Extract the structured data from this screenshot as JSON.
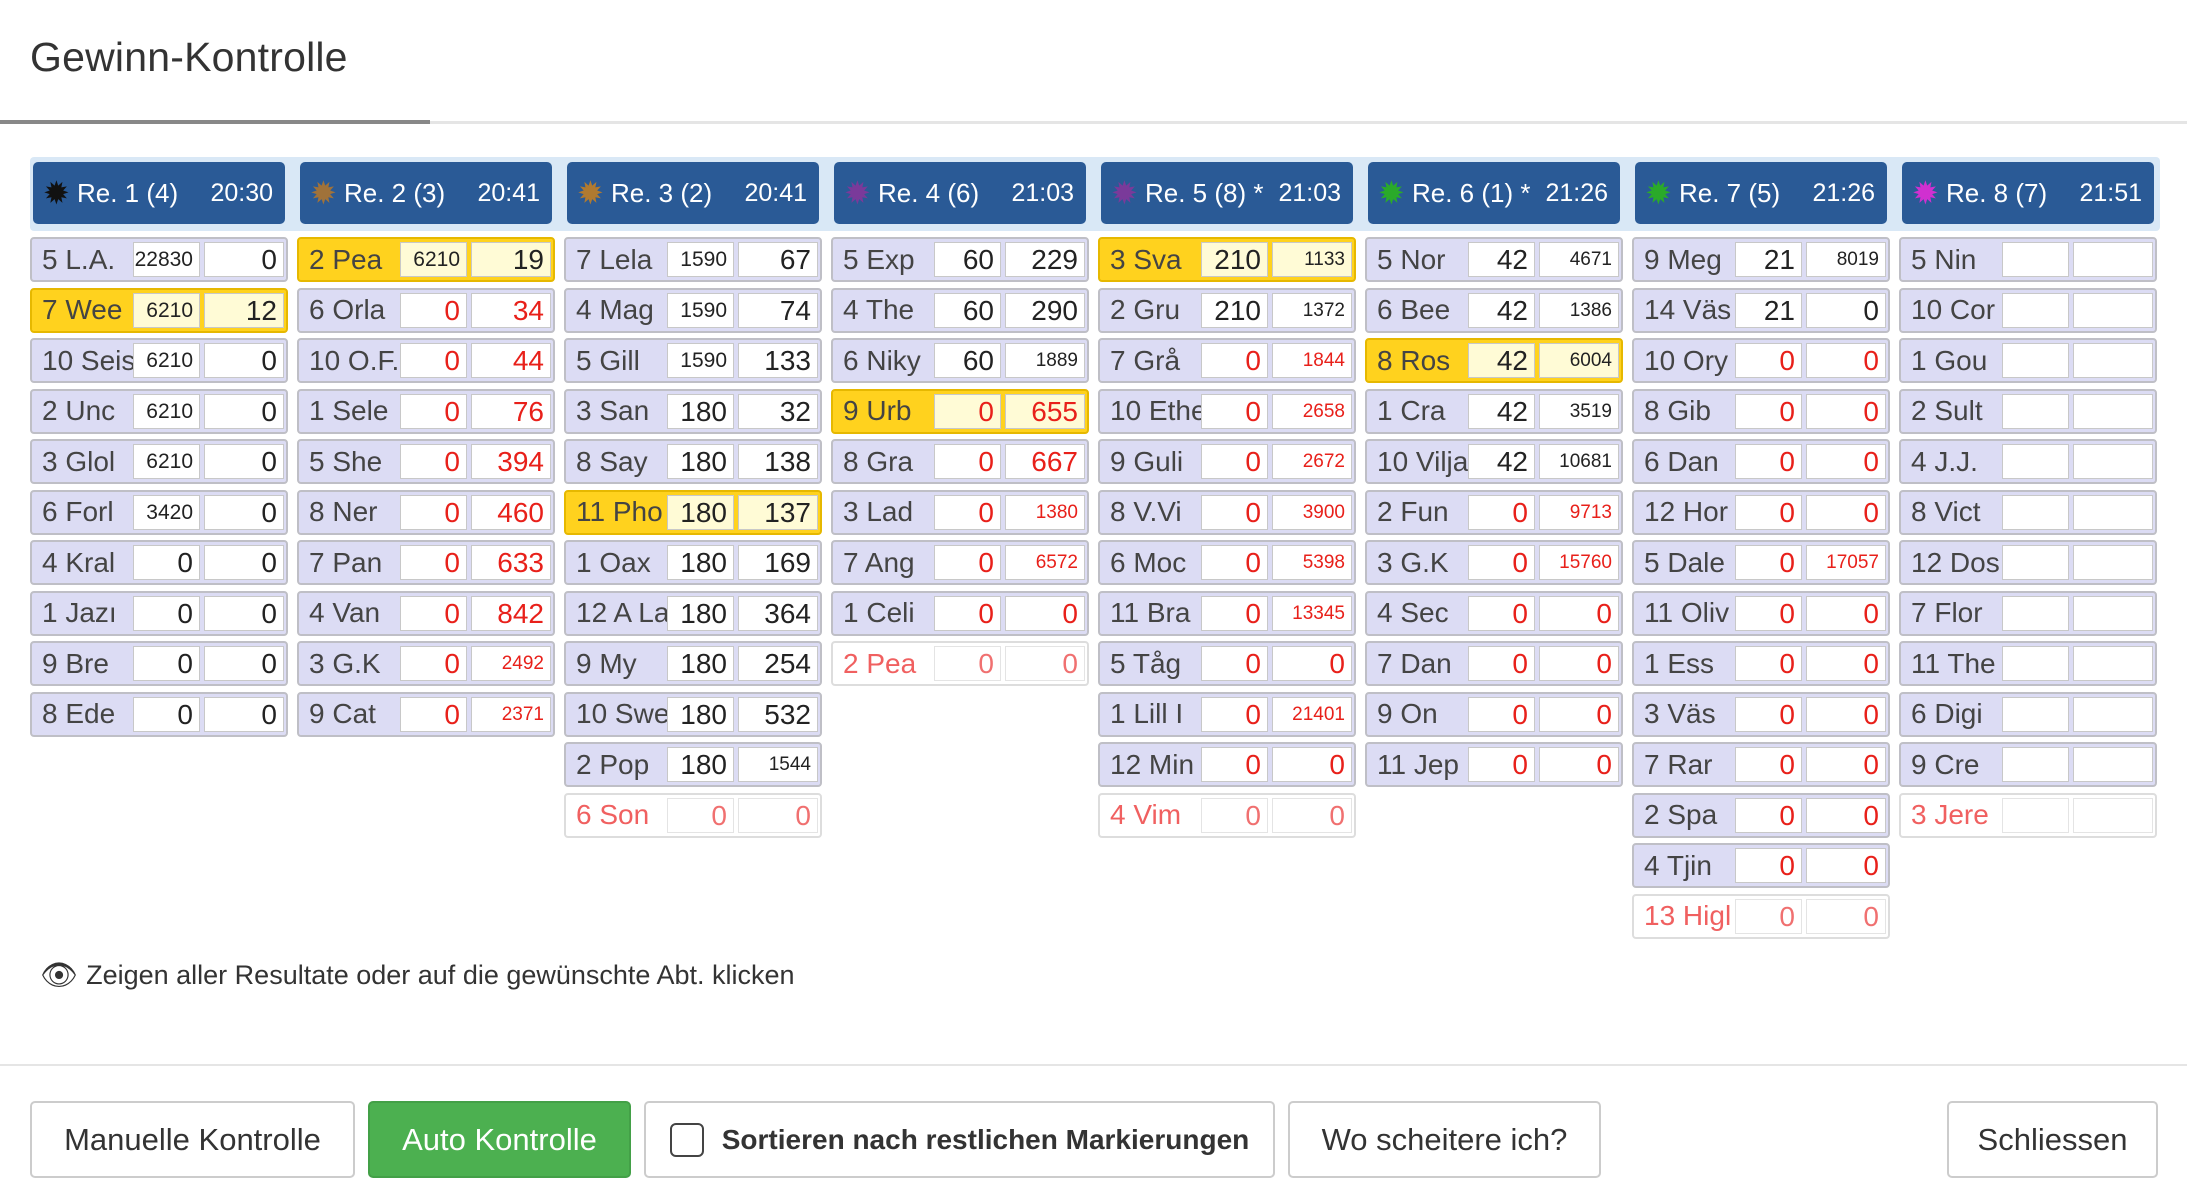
{
  "header": {
    "title": "Gewinn-Kontrolle"
  },
  "races": [
    {
      "star_color": "#111111",
      "label": "Re. 1 (4)",
      "time": "20:30",
      "rows": [
        {
          "name": "5 L.A.",
          "v1": "22830",
          "v2": "0",
          "state": "normal"
        },
        {
          "name": "7 Wee",
          "v1": "6210",
          "v2": "12",
          "state": "hl"
        },
        {
          "name": "10 Seis",
          "v1": "6210",
          "v2": "0",
          "state": "normal"
        },
        {
          "name": "2 Unc",
          "v1": "6210",
          "v2": "0",
          "state": "normal"
        },
        {
          "name": "3 Glol",
          "v1": "6210",
          "v2": "0",
          "state": "normal"
        },
        {
          "name": "6 Forl",
          "v1": "3420",
          "v2": "0",
          "state": "normal"
        },
        {
          "name": "4 Kral",
          "v1": "0",
          "v2": "0",
          "state": "normal"
        },
        {
          "name": "1 Jazı",
          "v1": "0",
          "v2": "0",
          "state": "normal"
        },
        {
          "name": "9 Bre",
          "v1": "0",
          "v2": "0",
          "state": "normal"
        },
        {
          "name": "8 Ede",
          "v1": "0",
          "v2": "0",
          "state": "normal"
        }
      ]
    },
    {
      "star_color": "#a0723a",
      "label": "Re. 2 (3)",
      "time": "20:41",
      "rows": [
        {
          "name": "2 Pea",
          "v1": "6210",
          "v2": "19",
          "state": "hl"
        },
        {
          "name": "6 Orla",
          "v1": "0",
          "v2": "34",
          "state": "normal",
          "red": true
        },
        {
          "name": "10 O.F.",
          "v1": "0",
          "v2": "44",
          "state": "normal",
          "red": true
        },
        {
          "name": "1 Sele",
          "v1": "0",
          "v2": "76",
          "state": "normal",
          "red": true
        },
        {
          "name": "5 She",
          "v1": "0",
          "v2": "394",
          "state": "normal",
          "red": true
        },
        {
          "name": "8 Ner",
          "v1": "0",
          "v2": "460",
          "state": "normal",
          "red": true
        },
        {
          "name": "7 Pan",
          "v1": "0",
          "v2": "633",
          "state": "normal",
          "red": true
        },
        {
          "name": "4 Van",
          "v1": "0",
          "v2": "842",
          "state": "normal",
          "red": true
        },
        {
          "name": "3 G.K",
          "v1": "0",
          "v2": "2492",
          "state": "normal",
          "red": true
        },
        {
          "name": "9 Cat",
          "v1": "0",
          "v2": "2371",
          "state": "normal",
          "red": true
        }
      ]
    },
    {
      "star_color": "#b07a30",
      "label": "Re. 3 (2)",
      "time": "20:41",
      "rows": [
        {
          "name": "7 Lela",
          "v1": "1590",
          "v2": "67",
          "state": "normal"
        },
        {
          "name": "4 Mag",
          "v1": "1590",
          "v2": "74",
          "state": "normal"
        },
        {
          "name": "5 Gill",
          "v1": "1590",
          "v2": "133",
          "state": "normal"
        },
        {
          "name": "3 San",
          "v1": "180",
          "v2": "32",
          "state": "normal"
        },
        {
          "name": "8 Say",
          "v1": "180",
          "v2": "138",
          "state": "normal"
        },
        {
          "name": "11 Pho",
          "v1": "180",
          "v2": "137",
          "state": "hl"
        },
        {
          "name": "1 Oax",
          "v1": "180",
          "v2": "169",
          "state": "normal"
        },
        {
          "name": "12 A La",
          "v1": "180",
          "v2": "364",
          "state": "normal"
        },
        {
          "name": "9 My",
          "v1": "180",
          "v2": "254",
          "state": "normal"
        },
        {
          "name": "10 Swe",
          "v1": "180",
          "v2": "532",
          "state": "normal"
        },
        {
          "name": "2 Pop",
          "v1": "180",
          "v2": "1544",
          "state": "normal"
        },
        {
          "name": "6 Son",
          "v1": "0",
          "v2": "0",
          "state": "scr"
        }
      ]
    },
    {
      "star_color": "#7a3a9a",
      "label": "Re. 4 (6)",
      "time": "21:03",
      "rows": [
        {
          "name": "5 Exp",
          "v1": "60",
          "v2": "229",
          "state": "normal"
        },
        {
          "name": "4 The",
          "v1": "60",
          "v2": "290",
          "state": "normal"
        },
        {
          "name": "6 Niky",
          "v1": "60",
          "v2": "1889",
          "state": "normal"
        },
        {
          "name": "9 Urb",
          "v1": "0",
          "v2": "655",
          "state": "hl",
          "red": true
        },
        {
          "name": "8 Gra",
          "v1": "0",
          "v2": "667",
          "state": "normal",
          "red": true
        },
        {
          "name": "3 Lad",
          "v1": "0",
          "v2": "1380",
          "state": "normal",
          "red": true
        },
        {
          "name": "7 Ang",
          "v1": "0",
          "v2": "6572",
          "state": "normal",
          "red": true
        },
        {
          "name": "1 Celi",
          "v1": "0",
          "v2": "0",
          "state": "normal",
          "red": true
        },
        {
          "name": "2 Pea",
          "v1": "0",
          "v2": "0",
          "state": "scr"
        }
      ]
    },
    {
      "star_color": "#7a3a9a",
      "label": "Re. 5 (8) *",
      "time": "21:03",
      "rows": [
        {
          "name": "3 Sva",
          "v1": "210",
          "v2": "1133",
          "state": "hl"
        },
        {
          "name": "2 Gru",
          "v1": "210",
          "v2": "1372",
          "state": "normal"
        },
        {
          "name": "7 Grå",
          "v1": "0",
          "v2": "1844",
          "state": "normal",
          "red": true
        },
        {
          "name": "10 Ethe",
          "v1": "0",
          "v2": "2658",
          "state": "normal",
          "red": true
        },
        {
          "name": "9 Guli",
          "v1": "0",
          "v2": "2672",
          "state": "normal",
          "red": true
        },
        {
          "name": "8 V.Vi",
          "v1": "0",
          "v2": "3900",
          "state": "normal",
          "red": true
        },
        {
          "name": "6 Moc",
          "v1": "0",
          "v2": "5398",
          "state": "normal",
          "red": true
        },
        {
          "name": "11 Bra",
          "v1": "0",
          "v2": "13345",
          "state": "normal",
          "red": true
        },
        {
          "name": "5 Tåg",
          "v1": "0",
          "v2": "0",
          "state": "normal",
          "red": true
        },
        {
          "name": "1 Lill I",
          "v1": "0",
          "v2": "21401",
          "state": "normal",
          "red": true
        },
        {
          "name": "12 Min",
          "v1": "0",
          "v2": "0",
          "state": "normal",
          "red": true
        },
        {
          "name": "4 Vim",
          "v1": "0",
          "v2": "0",
          "state": "scr"
        }
      ]
    },
    {
      "star_color": "#2aaa2a",
      "label": "Re. 6 (1) *",
      "time": "21:26",
      "rows": [
        {
          "name": "5 Nor",
          "v1": "42",
          "v2": "4671",
          "state": "normal"
        },
        {
          "name": "6 Bee",
          "v1": "42",
          "v2": "1386",
          "state": "normal"
        },
        {
          "name": "8 Ros",
          "v1": "42",
          "v2": "6004",
          "state": "hl"
        },
        {
          "name": "1 Cra",
          "v1": "42",
          "v2": "3519",
          "state": "normal"
        },
        {
          "name": "10 Vilja",
          "v1": "42",
          "v2": "10681",
          "state": "normal"
        },
        {
          "name": "2 Fun",
          "v1": "0",
          "v2": "9713",
          "state": "normal",
          "red": true
        },
        {
          "name": "3 G.K",
          "v1": "0",
          "v2": "15760",
          "state": "normal",
          "red": true
        },
        {
          "name": "4 Sec",
          "v1": "0",
          "v2": "0",
          "state": "normal",
          "red": true
        },
        {
          "name": "7 Dan",
          "v1": "0",
          "v2": "0",
          "state": "normal",
          "red": true
        },
        {
          "name": "9 On",
          "v1": "0",
          "v2": "0",
          "state": "normal",
          "red": true
        },
        {
          "name": "11 Jep",
          "v1": "0",
          "v2": "0",
          "state": "normal",
          "red": true
        }
      ]
    },
    {
      "star_color": "#2aaa2a",
      "label": "Re. 7 (5)",
      "time": "21:26",
      "rows": [
        {
          "name": "9 Meg",
          "v1": "21",
          "v2": "8019",
          "state": "normal"
        },
        {
          "name": "14 Väs",
          "v1": "21",
          "v2": "0",
          "state": "normal"
        },
        {
          "name": "10 Ory",
          "v1": "0",
          "v2": "0",
          "state": "normal",
          "red": true
        },
        {
          "name": "8 Gib",
          "v1": "0",
          "v2": "0",
          "state": "normal",
          "red": true
        },
        {
          "name": "6 Dan",
          "v1": "0",
          "v2": "0",
          "state": "normal",
          "red": true
        },
        {
          "name": "12 Hor",
          "v1": "0",
          "v2": "0",
          "state": "normal",
          "red": true
        },
        {
          "name": "5 Dale",
          "v1": "0",
          "v2": "17057",
          "state": "normal",
          "red": true
        },
        {
          "name": "11 Oliv",
          "v1": "0",
          "v2": "0",
          "state": "normal",
          "red": true
        },
        {
          "name": "1 Ess",
          "v1": "0",
          "v2": "0",
          "state": "normal",
          "red": true
        },
        {
          "name": "3 Väs",
          "v1": "0",
          "v2": "0",
          "state": "normal",
          "red": true
        },
        {
          "name": "7 Rar",
          "v1": "0",
          "v2": "0",
          "state": "normal",
          "red": true
        },
        {
          "name": "2 Spa",
          "v1": "0",
          "v2": "0",
          "state": "normal",
          "red": true
        },
        {
          "name": "4 Tjin",
          "v1": "0",
          "v2": "0",
          "state": "normal",
          "red": true
        },
        {
          "name": "13 Higl",
          "v1": "0",
          "v2": "0",
          "state": "scr"
        }
      ]
    },
    {
      "star_color": "#d030d0",
      "label": "Re. 8 (7)",
      "time": "21:51",
      "rows": [
        {
          "name": "5 Nin",
          "v1": "",
          "v2": "",
          "state": "normal"
        },
        {
          "name": "10 Cor",
          "v1": "",
          "v2": "",
          "state": "normal"
        },
        {
          "name": "1 Gou",
          "v1": "",
          "v2": "",
          "state": "normal"
        },
        {
          "name": "2 Sult",
          "v1": "",
          "v2": "",
          "state": "normal"
        },
        {
          "name": "4 J.J.",
          "v1": "",
          "v2": "",
          "state": "normal"
        },
        {
          "name": "8 Vict",
          "v1": "",
          "v2": "",
          "state": "normal"
        },
        {
          "name": "12 Dos",
          "v1": "",
          "v2": "",
          "state": "normal"
        },
        {
          "name": "7 Flor",
          "v1": "",
          "v2": "",
          "state": "normal"
        },
        {
          "name": "11 The",
          "v1": "",
          "v2": "",
          "state": "normal"
        },
        {
          "name": "6 Digi",
          "v1": "",
          "v2": "",
          "state": "normal"
        },
        {
          "name": "9 Cre",
          "v1": "",
          "v2": "",
          "state": "normal"
        },
        {
          "name": "3 Jere",
          "v1": "",
          "v2": "",
          "state": "scr"
        }
      ]
    }
  ],
  "hint": {
    "icon": "eye-icon",
    "text": "Zeigen aller Resultate oder auf die gewünschte Abt. klicken"
  },
  "footer": {
    "manual_label": "Manuelle Kontrolle",
    "auto_label": "Auto Kontrolle",
    "sort_label": "Sortieren nach restlichen Markierungen",
    "fail_label": "Wo scheitere ich?",
    "close_label": "Schliessen"
  },
  "colors": {
    "header_blue": "#2a5a96",
    "highlight": "#ffd21e",
    "row_bg": "#dcdcf4",
    "green": "#4cb050",
    "red": "#e8201a"
  }
}
